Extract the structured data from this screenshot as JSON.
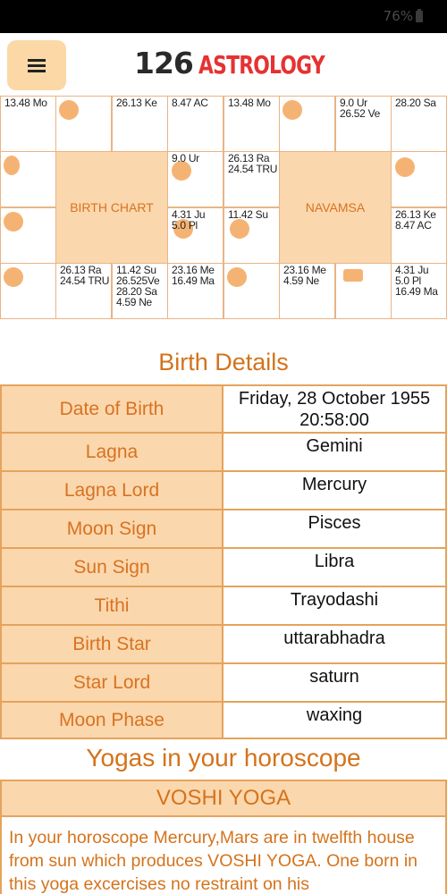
{
  "status": {
    "battery": "76%"
  },
  "header": {
    "logo_number": "126",
    "logo_word": "ASTROLOGY",
    "menu_icon": "hamburger-icon"
  },
  "birth_chart": {
    "center_label": "BIRTH CHART",
    "cells": [
      "13.48 Mo",
      "",
      "26.13 Ke",
      "8.47 AC",
      "",
      "9.0 Ur",
      "",
      "4.31 Ju\n5.0 Pl",
      "",
      "26.13 Ra\n24.54 TRU",
      "11.42 Su\n26.525Ve\n28.20 Sa\n4.59 Ne",
      "23.16 Me\n16.49 Ma"
    ]
  },
  "navamsa_chart": {
    "center_label": "NAVAMSA",
    "cells": [
      "13.48 Mo",
      "",
      "9.0 Ur\n26.52 Ve",
      "28.20 Sa",
      "26.13 Ra\n24.54 TRU",
      "",
      "11.42 Su",
      "26.13 Ke\n8.47 AC",
      "",
      "23.16 Me\n4.59 Ne",
      "",
      "4.31 Ju\n5.0 Pl\n16.49 Ma"
    ]
  },
  "birth_details": {
    "title": "Birth Details",
    "rows": [
      {
        "label": "Date of Birth",
        "value": "Friday, 28 October 1955 20:58:00"
      },
      {
        "label": "Lagna",
        "value": "Gemini"
      },
      {
        "label": "Lagna Lord",
        "value": "Mercury"
      },
      {
        "label": "Moon Sign",
        "value": "Pisces"
      },
      {
        "label": "Sun Sign",
        "value": "Libra"
      },
      {
        "label": "Tithi",
        "value": "Trayodashi"
      },
      {
        "label": "Birth Star",
        "value": "uttarabhadra"
      },
      {
        "label": "Star Lord",
        "value": "saturn"
      },
      {
        "label": "Moon Phase",
        "value": "waxing"
      }
    ]
  },
  "yogas": {
    "title": "Yogas in your horoscope",
    "items": [
      {
        "name": "VOSHI YOGA",
        "description": "In your horoscope Mercury,Mars are in twelfth house from sun which produces VOSHI YOGA. One born in this yoga excercises no restraint on his"
      }
    ]
  },
  "colors": {
    "accent": "#d4731c",
    "panel": "#fbd7ad",
    "border": "#e5a35c"
  }
}
